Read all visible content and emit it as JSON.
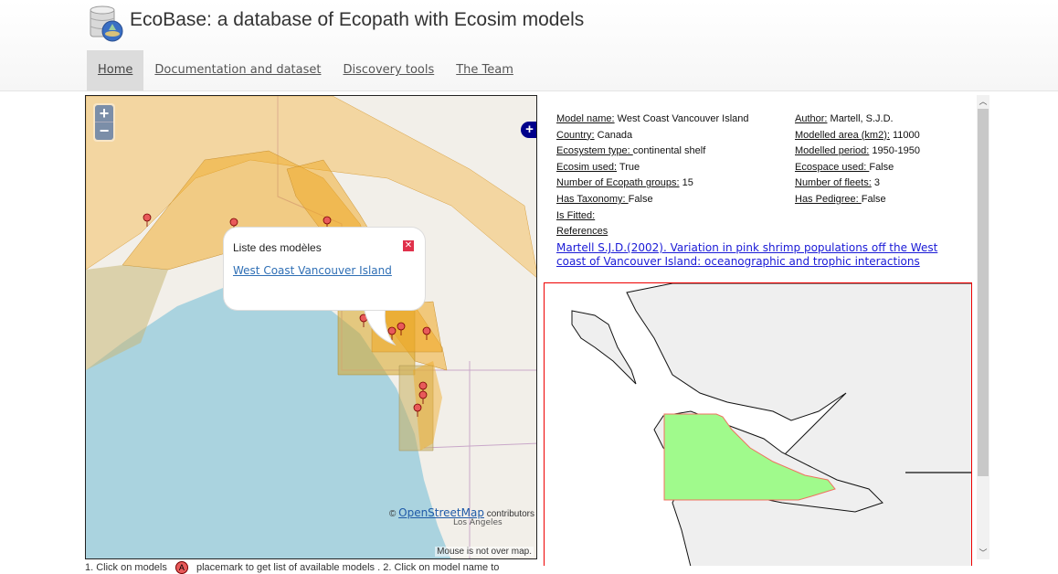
{
  "header": {
    "title": "EcoBase: a database of Ecopath with Ecosim models",
    "nav": [
      {
        "label": "Home",
        "active": true
      },
      {
        "label": "Documentation and dataset",
        "active": false
      },
      {
        "label": "Discovery tools",
        "active": false
      },
      {
        "label": "The Team",
        "active": false
      }
    ]
  },
  "map": {
    "zoom_in": "+",
    "zoom_out": "−",
    "layer_switcher": "+",
    "popup": {
      "title": "Liste des modèles",
      "close_icon": "close-icon",
      "model_link": "West Coast Vancouver Island"
    },
    "attribution_prefix": "©",
    "attribution_link": "OpenStreetMap",
    "attribution_suffix": "contributors",
    "city_label": "Los Angeles",
    "mouse_position": "Mouse is not over map.",
    "placemark_letter": "A"
  },
  "instructions": {
    "part1": "1. Click on models",
    "part2": "placemark to get list of available models . 2. Click on model name to"
  },
  "model_info": {
    "left": [
      {
        "key": "Model name:",
        "value": " West Coast Vancouver Island"
      },
      {
        "key": "Country:",
        "value": " Canada"
      },
      {
        "key": "Ecosystem type: ",
        "value": "continental shelf"
      },
      {
        "key": "Ecosim used:",
        "value": " True"
      },
      {
        "key": "Number of Ecopath groups:",
        "value": " 15"
      },
      {
        "key": "Has Taxonomy: ",
        "value": "False"
      },
      {
        "key": "Is Fitted:",
        "value": ""
      },
      {
        "key": "References",
        "value": ""
      }
    ],
    "right": [
      {
        "key": "Author:",
        "value": " Martell, S.J.D."
      },
      {
        "key": "Modelled area (km2):",
        "value": " 11000"
      },
      {
        "key": "Modelled period:",
        "value": " 1950-1950"
      },
      {
        "key": "Ecospace used: ",
        "value": "False"
      },
      {
        "key": "Number of fleets:",
        "value": " 3"
      },
      {
        "key": "Has Pedigree: ",
        "value": "False"
      }
    ],
    "reference": "Martell S.J.D.(2002). Variation in pink shrimp populations off the West coast of Vancouver Island: oceanographic and trophic interactions"
  },
  "colors": {
    "model_area_fill": "#a0fa8c",
    "model_area_stroke": "#f07060",
    "detail_border": "#e00000",
    "popup_close": "#e0314b",
    "link": "#1a1ad6"
  }
}
